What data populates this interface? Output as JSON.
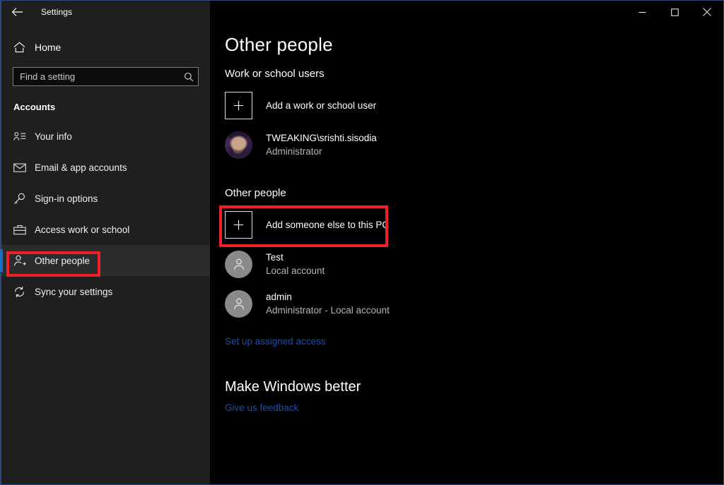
{
  "titlebar": {
    "back_icon": "back-arrow-icon",
    "title": "Settings",
    "minimize_label": "–",
    "maximize_label": "□",
    "close_label": "✕"
  },
  "sidebar": {
    "home": {
      "label": "Home",
      "icon": "home-icon"
    },
    "search": {
      "placeholder": "Find a setting",
      "value": "",
      "icon": "search-icon"
    },
    "section_title": "Accounts",
    "items": [
      {
        "label": "Your info",
        "icon": "person-card-icon",
        "selected": false
      },
      {
        "label": "Email & app accounts",
        "icon": "envelope-icon",
        "selected": false
      },
      {
        "label": "Sign-in options",
        "icon": "key-icon",
        "selected": false
      },
      {
        "label": "Access work or school",
        "icon": "briefcase-icon",
        "selected": false
      },
      {
        "label": "Other people",
        "icon": "person-plus-icon",
        "selected": true
      },
      {
        "label": "Sync your settings",
        "icon": "sync-icon",
        "selected": false
      }
    ],
    "accent_color": "#1a6fc4",
    "highlight_color": "#ef2026"
  },
  "main": {
    "page_title": "Other people",
    "work_section": {
      "heading": "Work or school users",
      "add_label": "Add a work or school user",
      "add_icon": "plus-icon",
      "users": [
        {
          "name": "TWEAKING\\srishti.sisodia",
          "role": "Administrator",
          "avatar": "photo-avatar"
        }
      ]
    },
    "other_section": {
      "heading": "Other people",
      "add_label": "Add someone else to this PC",
      "add_icon": "plus-icon",
      "users": [
        {
          "name": "Test",
          "role": "Local account",
          "avatar": "generic-person-avatar"
        },
        {
          "name": "admin",
          "role": "Administrator - Local account",
          "avatar": "generic-person-avatar"
        }
      ],
      "link": "Set up assigned access"
    },
    "feedback_section": {
      "heading": "Make Windows better",
      "link": "Give us feedback"
    },
    "link_color": "#1a4fb0"
  }
}
